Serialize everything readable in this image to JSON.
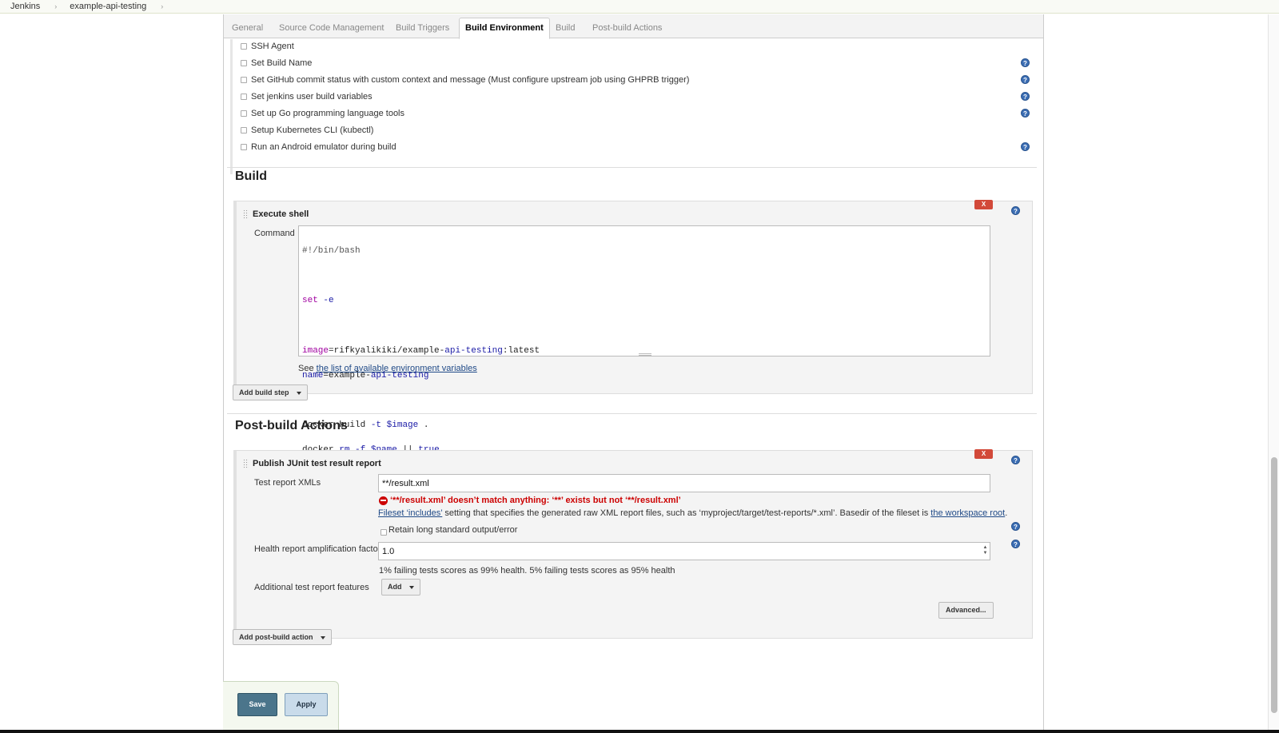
{
  "breadcrumb": [
    "Jenkins",
    "example-api-testing"
  ],
  "tabs": [
    {
      "label": "General"
    },
    {
      "label": "Source Code Management"
    },
    {
      "label": "Build Triggers"
    },
    {
      "label": "Build Environment",
      "active": true
    },
    {
      "label": "Build"
    },
    {
      "label": "Post-build Actions"
    }
  ],
  "build_environment": {
    "options": [
      {
        "label": "SSH Agent",
        "checked": false,
        "help": false
      },
      {
        "label": "Set Build Name",
        "checked": false,
        "help": true
      },
      {
        "label": "Set GitHub commit status with custom context and message (Must configure upstream job using GHPRB trigger)",
        "checked": false,
        "help": true
      },
      {
        "label": "Set jenkins user build variables",
        "checked": false,
        "help": true
      },
      {
        "label": "Set up Go programming language tools",
        "checked": false,
        "help": true
      },
      {
        "label": "Setup Kubernetes CLI (kubectl)",
        "checked": false,
        "help": false
      },
      {
        "label": "Run an Android emulator during build",
        "checked": false,
        "help": true
      }
    ]
  },
  "build": {
    "title": "Build",
    "execute_shell": {
      "title": "Execute shell",
      "delete_label": "X",
      "command_label": "Command",
      "command": "#!/bin/bash\n\nset -e\n\nimage=rifkyalikiki/example-api-testing:latest\nname=example-api-testing\n\ndocker build -t $image .\ndocker rm -f $name || true\ndocker run --name $name $image run\ndocker cp $name:/app/test-result .",
      "see_prefix": "See",
      "env_link": "the list of available environment variables"
    },
    "add_step_label": "Add build step"
  },
  "post_build": {
    "title": "Post-build Actions",
    "junit": {
      "title": "Publish JUnit test result report",
      "delete_label": "X",
      "test_report_label": "Test report XMLs",
      "test_report_value": "**/result.xml",
      "error": "‘**/result.xml’ doesn’t match anything: ‘**’ exists but not ‘**/result.xml’",
      "desc_link1": "Fileset ‘includes’",
      "desc_mid": "setting that specifies the generated raw XML report files, such as ‘myproject/target/test-reports/*.xml’. Basedir of the fileset is",
      "desc_link2": "the workspace root",
      "desc_end": ".",
      "retain_label": "Retain long standard output/error",
      "retain_checked": false,
      "health_label": "Health report amplification factor",
      "health_value": "1.0",
      "health_hint": "1% failing tests scores as 99% health. 5% failing tests scores as 95% health",
      "features_label": "Additional test report features",
      "add_label": "Add",
      "advanced_label": "Advanced..."
    },
    "add_action_label": "Add post-build action"
  },
  "footer": {
    "save_label": "Save",
    "apply_label": "Apply"
  },
  "icons": {
    "help": "question-circle-icon",
    "error": "error-circle-icon",
    "caret": "caret-down-icon",
    "separator": "chevron-right-icon"
  },
  "colors": {
    "help_blue": "#3c6eb4",
    "error_red": "#cc0000",
    "delete_red": "#d24939",
    "save_button": "#4b758b",
    "apply_button": "#c9dbea"
  }
}
